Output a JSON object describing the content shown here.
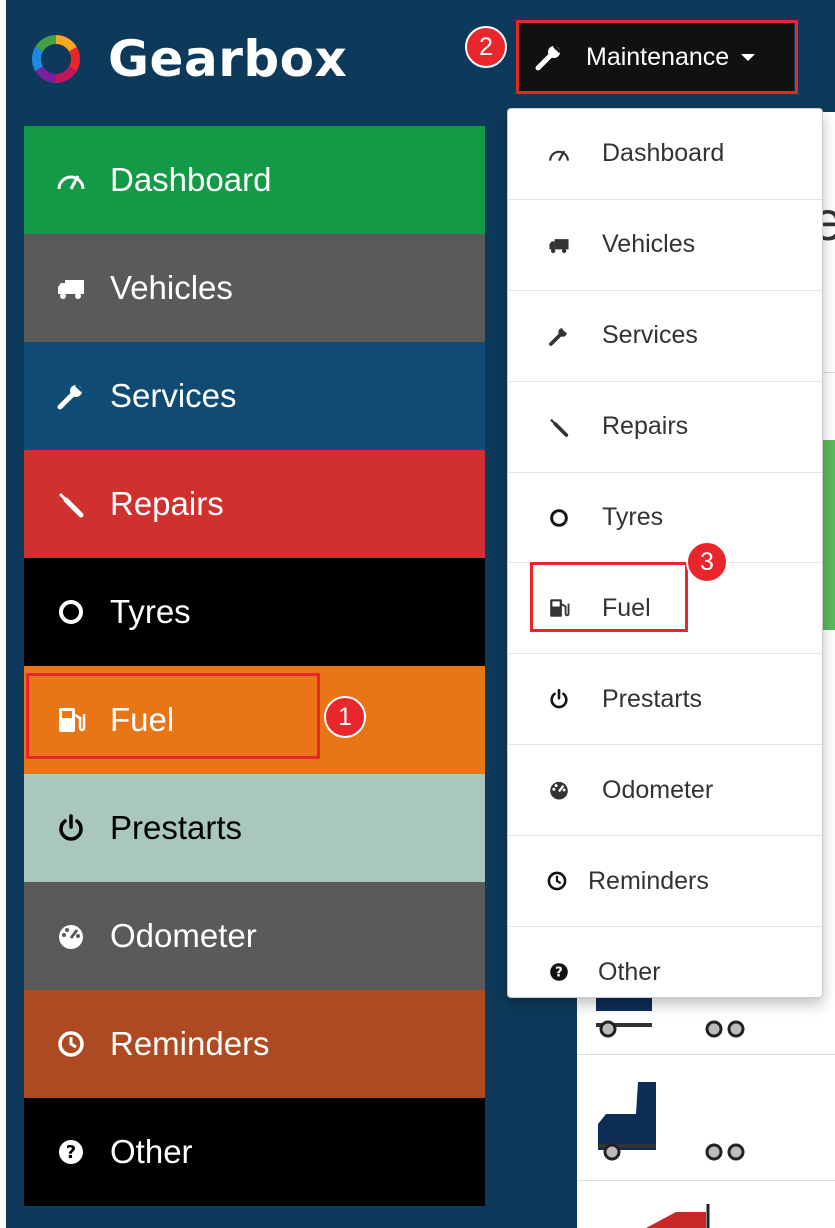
{
  "brand": {
    "name": "Gearbox"
  },
  "sidebar": {
    "items": [
      {
        "label": "Dashboard",
        "icon": "tachometer-icon",
        "color": "#149a47"
      },
      {
        "label": "Vehicles",
        "icon": "truck-icon",
        "color": "#5a5a5a"
      },
      {
        "label": "Services",
        "icon": "wrench-icon",
        "color": "#0f4b74"
      },
      {
        "label": "Repairs",
        "icon": "screwdriver-icon",
        "color": "#d0302e"
      },
      {
        "label": "Tyres",
        "icon": "circle-icon",
        "color": "#000000"
      },
      {
        "label": "Fuel",
        "icon": "fuel-pump-icon",
        "color": "#e87617"
      },
      {
        "label": "Prestarts",
        "icon": "power-icon",
        "color": "#a9c6bf"
      },
      {
        "label": "Odometer",
        "icon": "gauge-icon",
        "color": "#5a5a5a"
      },
      {
        "label": "Reminders",
        "icon": "clock-icon",
        "color": "#ad4a22"
      },
      {
        "label": "Other",
        "icon": "question-icon",
        "color": "#000000"
      }
    ]
  },
  "header": {
    "maintenance_label": "Maintenance"
  },
  "dropdown": {
    "items": [
      {
        "label": "Dashboard",
        "icon": "tachometer-icon"
      },
      {
        "label": "Vehicles",
        "icon": "truck-icon"
      },
      {
        "label": "Services",
        "icon": "wrench-icon"
      },
      {
        "label": "Repairs",
        "icon": "screwdriver-icon"
      },
      {
        "label": "Tyres",
        "icon": "circle-icon"
      },
      {
        "label": "Fuel",
        "icon": "fuel-pump-icon"
      },
      {
        "label": "Prestarts",
        "icon": "power-icon"
      },
      {
        "label": "Odometer",
        "icon": "gauge-icon"
      },
      {
        "label": "Reminders",
        "icon": "clock-icon"
      },
      {
        "label": "Other",
        "icon": "question-icon"
      }
    ]
  },
  "annotations": {
    "badge1": "1",
    "badge2": "2",
    "badge3": "3"
  },
  "colors": {
    "sidebar_bg": "#0d3a5a",
    "highlight": "#e8262b"
  }
}
